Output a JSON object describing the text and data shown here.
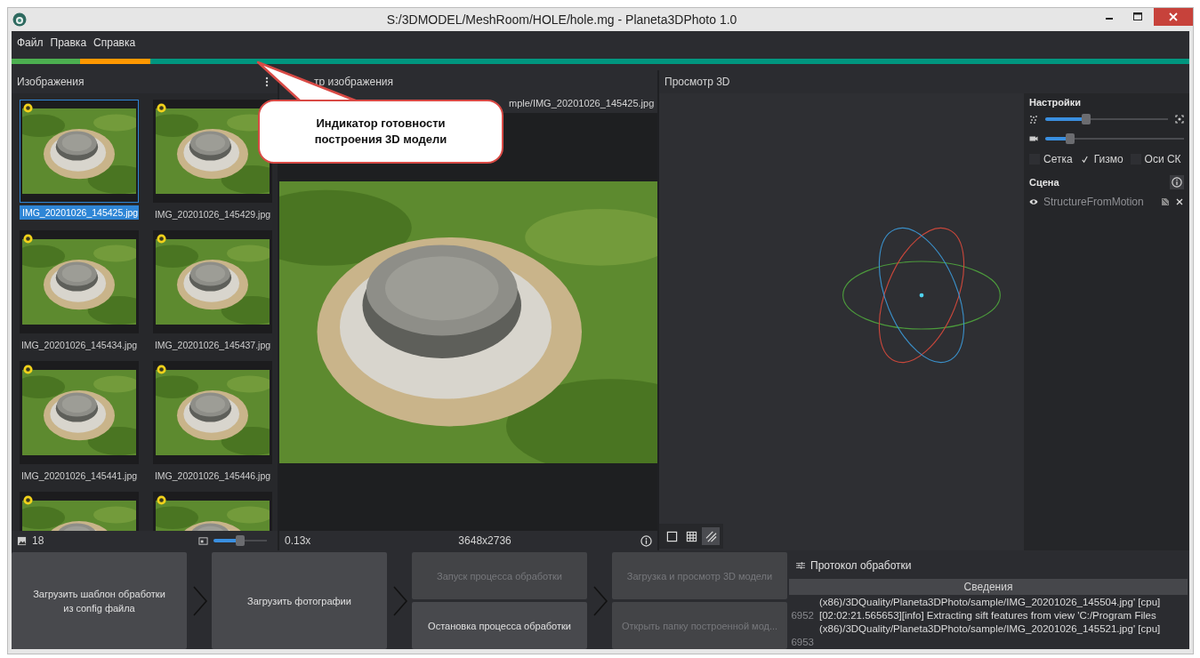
{
  "window": {
    "title": "S:/3DMODEL/MeshRoom/HOLE/hole.mg - Planeta3DPhoto 1.0"
  },
  "menu": [
    "Файл",
    "Правка",
    "Справка"
  ],
  "progress": {
    "segments": [
      {
        "color": "#4caf50",
        "level": 0.058
      },
      {
        "color": "#ff9800",
        "level": 0.06
      },
      {
        "color": "#00967f",
        "level": 0.882
      }
    ]
  },
  "callout": {
    "text": "Индикатор готовности\nпостроения 3D модели"
  },
  "images": {
    "title": "Изображения",
    "items": [
      {
        "name": "IMG_20201026_145425.jpg",
        "selected": true
      },
      {
        "name": "IMG_20201026_145429.jpg",
        "selected": false
      },
      {
        "name": "IMG_20201026_145434.jpg",
        "selected": false
      },
      {
        "name": "IMG_20201026_145437.jpg",
        "selected": false
      },
      {
        "name": "IMG_20201026_145441.jpg",
        "selected": false
      },
      {
        "name": "IMG_20201026_145446.jpg",
        "selected": false
      },
      {
        "selected": false
      },
      {
        "selected": false
      }
    ],
    "count": "18",
    "thumb_size": {
      "level": 0.5
    }
  },
  "viewer": {
    "title": "тр изображения",
    "path": "mple/IMG_20201026_145425.jpg",
    "zoom": "0.13x",
    "resolution": "3648x2736"
  },
  "view3d": {
    "title": "Просмотр 3D",
    "modes": [
      {
        "kind": "plain",
        "selected": false
      },
      {
        "kind": "grid",
        "selected": false
      },
      {
        "kind": "hatched",
        "selected": true
      }
    ]
  },
  "settings": {
    "title": "Настройки",
    "sliders": [
      {
        "kind": "points",
        "level": 0.33
      },
      {
        "kind": "camera",
        "level": 0.18
      }
    ],
    "options": [
      {
        "label": "Сетка",
        "checked": false
      },
      {
        "label": "Гизмо",
        "checked": true
      },
      {
        "label": "Оси СК",
        "checked": false
      }
    ],
    "scene_title": "Сцена",
    "scene_items": [
      {
        "name": "StructureFromMotion"
      }
    ]
  },
  "actions": [
    {
      "buttons": [
        {
          "label": "Загрузить шаблон обработки\nиз config файла",
          "disabled": false
        }
      ]
    },
    {
      "buttons": [
        {
          "label": "Загрузить фотографии",
          "disabled": false
        }
      ]
    },
    {
      "buttons": [
        {
          "label": "Запуск процесса обработки",
          "disabled": true
        },
        {
          "label": "Остановка процесса обработки",
          "disabled": false
        }
      ]
    },
    {
      "buttons": [
        {
          "label": "Загрузка и просмотр 3D модели",
          "disabled": true
        },
        {
          "label": "Открыть папку построенной мод...",
          "disabled": true
        }
      ]
    }
  ],
  "log": {
    "title": "Протокол обработки",
    "column": "Сведения",
    "lines": [
      {
        "text": "(x86)/3DQuality/Planeta3DPhoto/sample/IMG_20201026_145504.jpg' [cpu]"
      },
      {
        "number": "6952",
        "text": "[02:02:21.565653][info] Extracting sift features from view 'C:/Program Files"
      },
      {
        "text": "(x86)/3DQuality/Planeta3DPhoto/sample/IMG_20201026_145521.jpg' [cpu]"
      },
      {
        "number": "6953"
      }
    ]
  }
}
